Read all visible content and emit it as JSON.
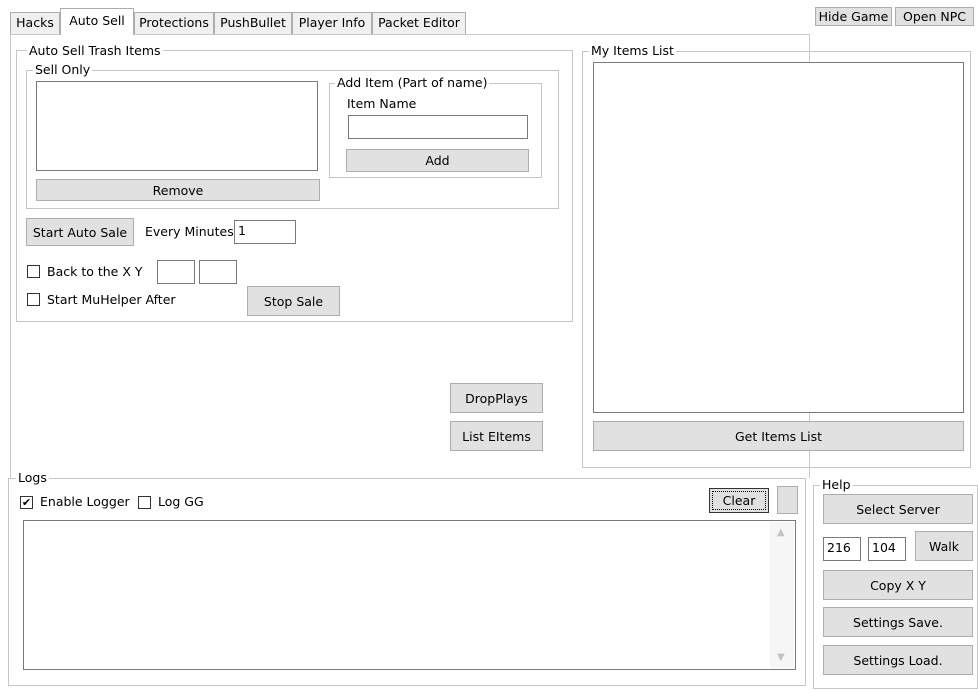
{
  "tabs": {
    "hacks": "Hacks",
    "auto_sell": "Auto Sell",
    "protections": "Protections",
    "pushbullet": "PushBullet",
    "player_info": "Player Info",
    "packet_editor": "Packet Editor"
  },
  "top_buttons": {
    "hide_game": "Hide Game",
    "open_npc": "Open NPC"
  },
  "auto_sell": {
    "group_title": "Auto Sell Trash Items",
    "sell_only_title": "Sell Only",
    "remove_label": "Remove",
    "add_item_title": "Add Item (Part of name)",
    "item_name_label": "Item Name",
    "item_name_value": "",
    "add_label": "Add",
    "start_label": "Start Auto Sale",
    "every_minutes_label": "Every Minutes",
    "every_minutes_value": "1",
    "back_to_xy_label": "Back to the X Y",
    "back_x_value": "",
    "back_y_value": "",
    "start_muhelper_label": "Start MuHelper After",
    "stop_label": "Stop Sale"
  },
  "actions": {
    "dropplays": "DropPlays",
    "list_eitems": "List EItems"
  },
  "my_items": {
    "title": "My Items List",
    "get_label": "Get Items List"
  },
  "logs": {
    "title": "Logs",
    "enable_logger_label": "Enable Logger",
    "enable_logger_checked": true,
    "log_gg_label": "Log GG",
    "log_gg_checked": false,
    "clear_label": "Clear"
  },
  "help": {
    "title": "Help",
    "select_server": "Select Server",
    "x_value": "216",
    "y_value": "104",
    "walk": "Walk",
    "copy_xy": "Copy X Y",
    "settings_save": "Settings Save.",
    "settings_load": "Settings Load."
  },
  "icons": {
    "check": "✔",
    "up_arrow": "▲",
    "down_arrow": "▼"
  }
}
